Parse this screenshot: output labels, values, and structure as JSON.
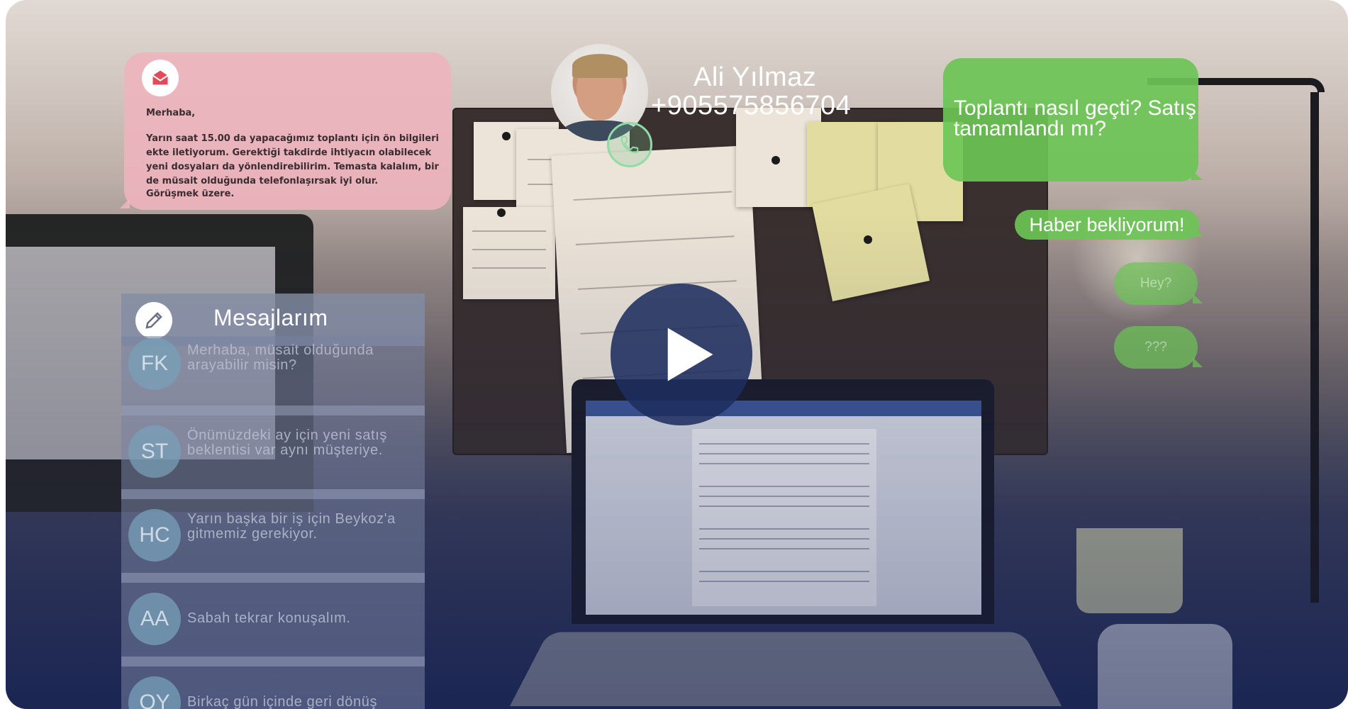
{
  "email": {
    "greeting": "Merhaba,",
    "body": "Yarın saat 15.00 da yapacağımız toplantı için ön bilgileri ekte iletiyorum. Gerektiği takdirde ihtiyacın olabilecek yeni dosyaları da yönlendirebilirim. Temasta kalalım, bir de müsait olduğunda telefonlaşırsak iyi olur.",
    "signoff": "Görüşmek üzere.",
    "icon": "envelope-icon"
  },
  "caller": {
    "name": "Ali Yılmaz",
    "phone": "+905575856704",
    "icon": "phone-icon"
  },
  "chat": {
    "main": "Toplantı nasıl geçti? Satış tamamlandı mı?",
    "followup": "Haber bekliyorum!",
    "hey": "Hey?",
    "qmarks": "???",
    "color": "#6cc456"
  },
  "messages": {
    "title": "Mesajlarım",
    "icon": "pencil-icon",
    "items": [
      {
        "initials": "FK",
        "text": "Merhaba, müsait olduğunda arayabilir misin?"
      },
      {
        "initials": "ST",
        "text": "Önümüzdeki ay için yeni satış beklentisi var aynı müşteriye."
      },
      {
        "initials": "HC",
        "text": "Yarın başka bir iş için Beykoz'a gitmemiz gerekiyor."
      },
      {
        "initials": "AA",
        "text": "Sabah tekrar konuşalım."
      },
      {
        "initials": "OY",
        "text": "Birkaç gün içinde geri dönüş"
      }
    ]
  },
  "video": {
    "play_icon": "play-icon",
    "accent": "#1e2d5f"
  }
}
